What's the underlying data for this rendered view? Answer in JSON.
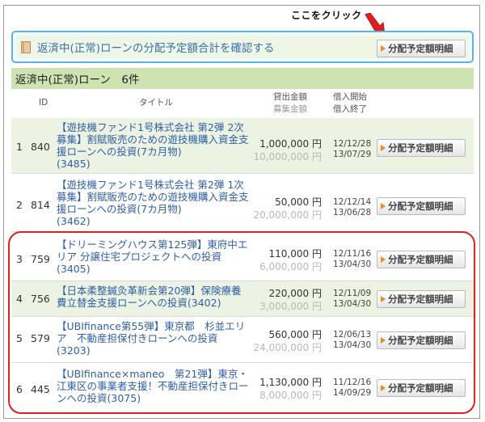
{
  "annotation": {
    "text": "ここをクリック"
  },
  "summary": {
    "link": "返済中(正常)ローンの分配予定額合計を確認する",
    "button": "分配予定額明細"
  },
  "section": {
    "title": "返済中(正常)ローン　6件"
  },
  "headers": {
    "id": "ID",
    "title": "タイトル",
    "amount_lent": "貸出金額",
    "amount_raised": "募集金額",
    "borrow_start": "借入開始",
    "borrow_end": "借入終了"
  },
  "rows": [
    {
      "no": "1",
      "id": "840",
      "title": "【遊技機ファンド1号株式会社 第2弾 2次募集】割賦販売のための遊技機購入資金支援ローンへの投資(7カ月物)",
      "code": "(3485)",
      "amount": "1,000,000",
      "amount_unit": "円",
      "raised": "10,000,000",
      "raised_unit": "円",
      "start": "12/12/28",
      "end": "13/07/29",
      "button": "分配予定額明細"
    },
    {
      "no": "2",
      "id": "814",
      "title": "【遊技機ファンド1号株式会社 第2弾 1次募集】割賦販売のための遊技機購入資金支援ローンへの投資(7カ月物)",
      "code": "(3462)",
      "amount": "50,000",
      "amount_unit": "円",
      "raised": "20,000,000",
      "raised_unit": "円",
      "start": "12/12/14",
      "end": "13/06/28",
      "button": "分配予定額明細"
    },
    {
      "no": "3",
      "id": "759",
      "title": "【ドリーミングハウス第125弾】東府中エリア 分譲住宅プロジェクトへの投資",
      "code": "(3405)",
      "amount": "110,000",
      "amount_unit": "円",
      "raised": "6,000,000",
      "raised_unit": "円",
      "start": "12/11/16",
      "end": "13/04/30",
      "button": "分配予定額明細"
    },
    {
      "no": "4",
      "id": "756",
      "title": "【日本柔整鍼灸革新会第20弾】保険療養費立替金支援ローンへの投資",
      "code": "(3402)",
      "amount": "220,000",
      "amount_unit": "円",
      "raised": "3,000,000",
      "raised_unit": "円",
      "start": "12/11/09",
      "end": "13/04/30",
      "button": "分配予定額明細"
    },
    {
      "no": "5",
      "id": "579",
      "title": "【UBIfinance第55弾】東京都　杉並エリア　不動産担保付きローンへの投資",
      "code": "(3203)",
      "amount": "560,000",
      "amount_unit": "円",
      "raised": "24,000,000",
      "raised_unit": "円",
      "start": "12/06/13",
      "end": "13/04/30",
      "button": "分配予定額明細"
    },
    {
      "no": "6",
      "id": "445",
      "title": "【UBIfinance×maneo　第21弾】東京・江東区の事業者支援！不動産担保付きローンへの投資",
      "code": "(3075)",
      "amount": "1,130,000",
      "amount_unit": "円",
      "raised": "8,000,000",
      "raised_unit": "円",
      "start": "11/12/16",
      "end": "14/09/29",
      "button": "分配予定額明細"
    }
  ],
  "colors": {
    "accent": "#f08a24",
    "highlight": "#e02020",
    "link": "#2f5fa7",
    "header_bg": "#cfe3b2",
    "summary_border": "#5eb2dc"
  }
}
